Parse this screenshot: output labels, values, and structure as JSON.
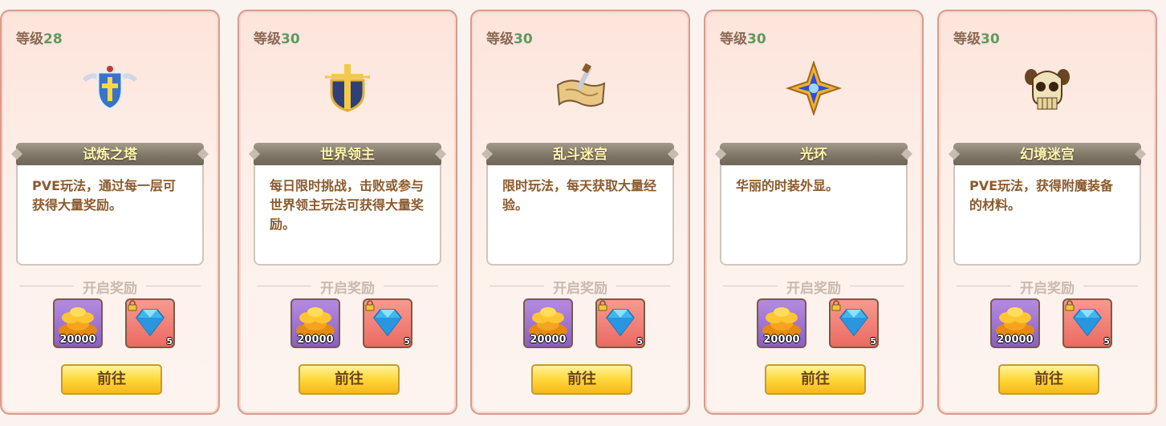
{
  "level_label": "等级",
  "reward_heading": "开启奖励",
  "go_label": "前往",
  "cards": [
    {
      "level": "28",
      "title": "试炼之塔",
      "desc": "PVE玩法，通过每一层可获得大量奖励。",
      "emblem": "shield-cross-icon",
      "gold": "20000",
      "gem_lock": "5"
    },
    {
      "level": "30",
      "title": "世界领主",
      "desc": "每日限时挑战，击败或参与世界领主玩法可获得大量奖励。",
      "emblem": "sword-emblem-icon",
      "gold": "20000",
      "gem_lock": "5"
    },
    {
      "level": "30",
      "title": "乱斗迷宫",
      "desc": "限时玩法，每天获取大量经验。",
      "emblem": "map-sword-icon",
      "gold": "20000",
      "gem_lock": "5"
    },
    {
      "level": "30",
      "title": "光环",
      "desc": "华丽的时装外显。",
      "emblem": "star-halo-icon",
      "gold": "20000",
      "gem_lock": "5"
    },
    {
      "level": "30",
      "title": "幻境迷宫",
      "desc": "PVE玩法，获得附魔装备的材料。",
      "emblem": "skull-icon",
      "gold": "20000",
      "gem_lock": "5"
    }
  ]
}
